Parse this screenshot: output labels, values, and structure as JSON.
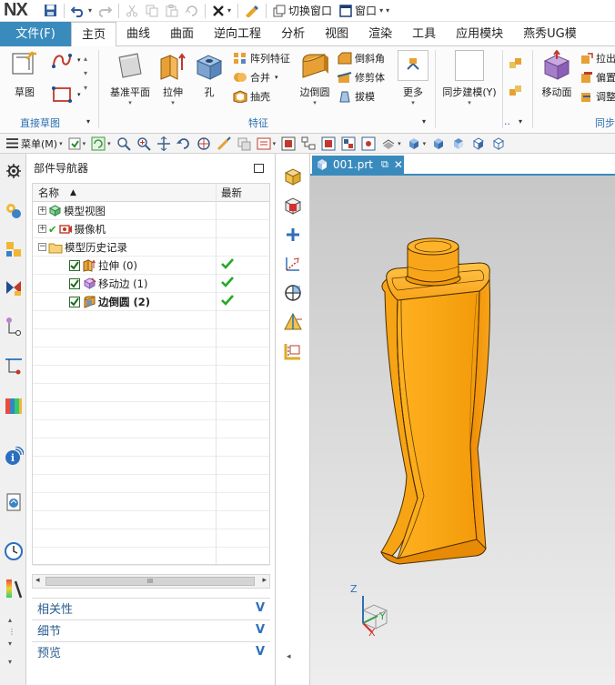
{
  "app": {
    "logo": "NX",
    "quick_access": {
      "switch_window_label": "切换窗口",
      "window_label": "窗口"
    }
  },
  "tabs": [
    {
      "label": "文件(F)"
    },
    {
      "label": "主页"
    },
    {
      "label": "曲线"
    },
    {
      "label": "曲面"
    },
    {
      "label": "逆向工程"
    },
    {
      "label": "分析"
    },
    {
      "label": "视图"
    },
    {
      "label": "渲染"
    },
    {
      "label": "工具"
    },
    {
      "label": "应用模块"
    },
    {
      "label": "燕秀UG模"
    }
  ],
  "ribbon": {
    "sketch_group": {
      "sketch_label": "草图",
      "group_label": "直接草图"
    },
    "feature_group": {
      "datum_plane_label": "基准平面",
      "extrude_label": "拉伸",
      "hole_label": "孔",
      "pattern_feature_label": "阵列特征",
      "unite_label": "合并",
      "shell_label": "抽壳",
      "edge_blend_label": "边倒圆",
      "chamfer_label": "倒斜角",
      "trim_body_label": "修剪体",
      "draft_label": "拔模",
      "more_label": "更多",
      "group_label": "特征"
    },
    "sync_group": {
      "sync_modeling_label": "同步建模(Y)",
      "move_face_label": "移动面",
      "pull_face_label": "拉出",
      "offset_label": "偏置",
      "adjust_label": "调整",
      "group_label": "同步"
    }
  },
  "cmdbar": {
    "menu_label": "菜单(M)"
  },
  "navigator": {
    "title": "部件导航器",
    "col_name": "名称",
    "col_latest": "最新",
    "rows": [
      {
        "label": "模型视图"
      },
      {
        "label": "摄像机"
      },
      {
        "label": "模型历史记录"
      },
      {
        "label": "拉伸 (0)"
      },
      {
        "label": "移动边 (1)"
      },
      {
        "label": "边倒圆 (2)"
      }
    ],
    "scroll_grip": "III",
    "panels": [
      {
        "label": "相关性"
      },
      {
        "label": "细节"
      },
      {
        "label": "预览"
      }
    ]
  },
  "document": {
    "tab_label": "001.prt"
  },
  "triad": {
    "x": "X",
    "y": "Y",
    "z": "Z"
  },
  "colors": {
    "accent": "#3a8bbd",
    "model": "#f59b0c",
    "check": "#27a827"
  }
}
